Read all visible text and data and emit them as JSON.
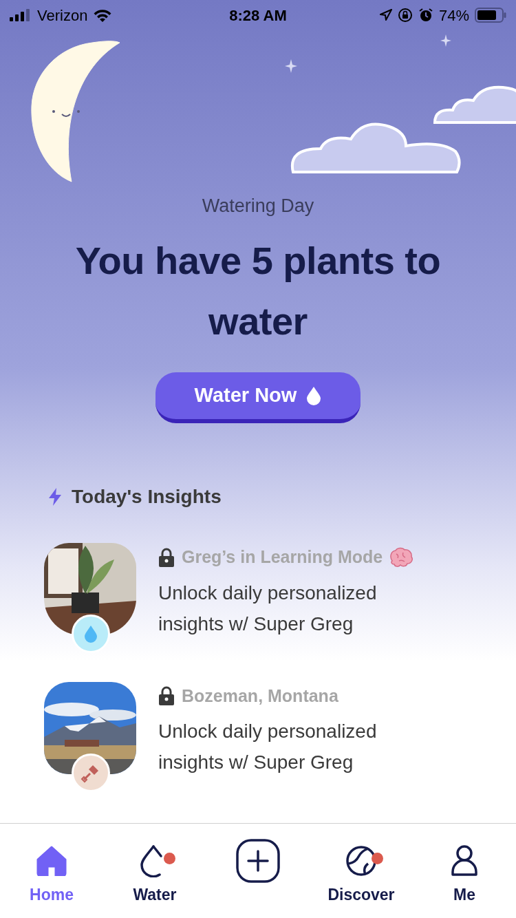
{
  "status_bar": {
    "carrier": "Verizon",
    "time": "8:28 AM",
    "battery": "74%"
  },
  "hero": {
    "eyebrow": "Watering Day",
    "headline": "You have 5 plants to water",
    "button": "Water Now"
  },
  "insights": {
    "title": "Today's Insights",
    "items": [
      {
        "kind": "plant",
        "badge": {
          "kind": "water"
        },
        "label": "Greg’s in Learning Mode",
        "brain": true,
        "text": "Unlock daily personalized insights w/ Super Greg"
      },
      {
        "kind": "landscape",
        "badge": {
          "kind": "shovel"
        },
        "label": "Bozeman, Montana",
        "brain": false,
        "text": "Unlock daily personalized insights w/ Super Greg"
      }
    ]
  },
  "tabs": [
    {
      "kind": "home",
      "label": "Home",
      "selected": true,
      "dot": false
    },
    {
      "kind": "water",
      "label": "Water",
      "selected": false,
      "dot": true
    },
    {
      "kind": "add",
      "selected": false,
      "dot": false
    },
    {
      "kind": "discover",
      "label": "Discover",
      "selected": false,
      "dot": true
    },
    {
      "kind": "me",
      "label": "Me",
      "selected": false,
      "dot": false
    }
  ]
}
